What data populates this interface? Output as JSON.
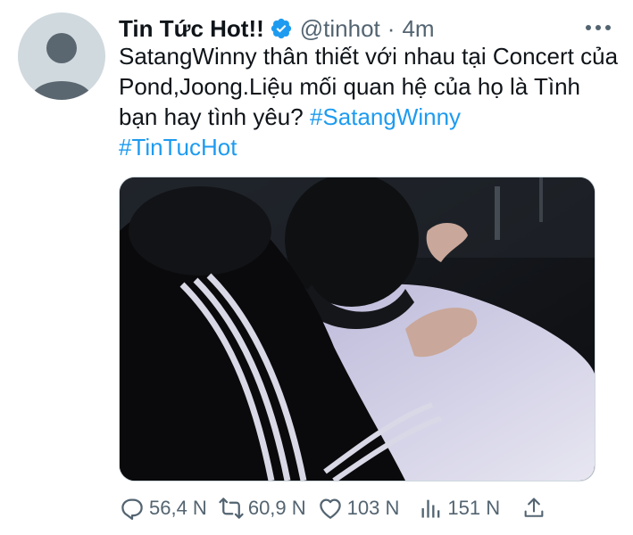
{
  "tweet": {
    "author_name": "Tin Tức Hot!!",
    "handle": "@tinhot",
    "separator": "·",
    "time": "4m",
    "text_main": "SatangWinny thân thiết với nhau tại Concert của Pond,Joong.Liệu mối quan hệ của họ là Tình bạn hay tình yêu?",
    "hashtags": [
      "#SatangWinny",
      "#TinTucHot"
    ],
    "media_alt": "photo"
  },
  "actions": {
    "replies": "56,4 N",
    "retweets": "60,9 N",
    "likes": "103 N",
    "views": "151 N"
  },
  "icons": {
    "avatar": "default-avatar-icon",
    "verified": "verified-badge-icon",
    "more": "more-dots-icon",
    "reply": "reply-icon",
    "retweet": "retweet-icon",
    "like": "heart-icon",
    "views": "views-icon",
    "share": "share-icon"
  },
  "colors": {
    "accent": "#1d9bf0",
    "text": "#0f1419",
    "muted": "#536471",
    "avatar_bg": "#cfd9de"
  }
}
